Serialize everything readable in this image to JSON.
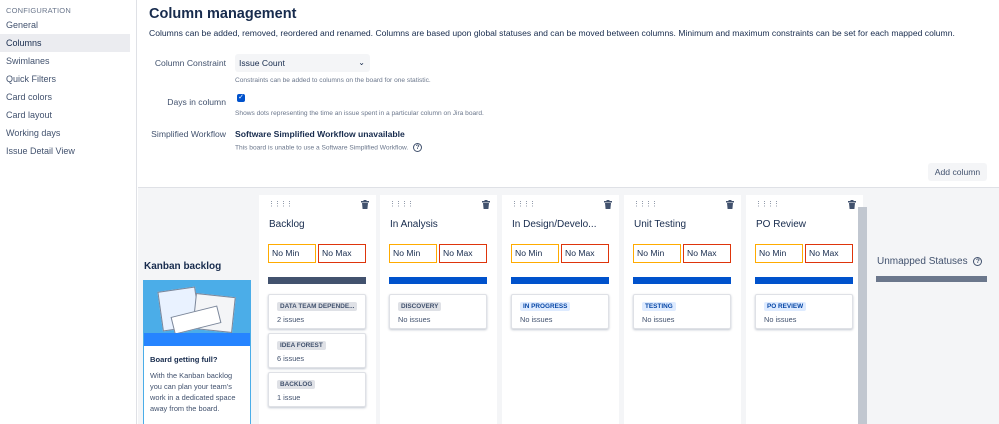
{
  "sidebar": {
    "heading": "CONFIGURATION",
    "items": [
      {
        "label": "General"
      },
      {
        "label": "Columns"
      },
      {
        "label": "Swimlanes"
      },
      {
        "label": "Quick Filters"
      },
      {
        "label": "Card colors"
      },
      {
        "label": "Card layout"
      },
      {
        "label": "Working days"
      },
      {
        "label": "Issue Detail View"
      }
    ],
    "active": "Columns"
  },
  "page": {
    "title": "Column management",
    "description": "Columns can be added, removed, reordered and renamed. Columns are based upon global statuses and can be moved between columns. Minimum and maximum constraints can be set for each mapped column."
  },
  "form": {
    "constraint_label": "Column Constraint",
    "constraint_value": "Issue Count",
    "constraint_help": "Constraints can be added to columns on the board for one statistic.",
    "days_label": "Days in column",
    "days_checked": true,
    "days_help": "Shows dots representing the time an issue spent in a particular column on Jira board.",
    "workflow_label": "Simplified Workflow",
    "workflow_title": "Software Simplified Workflow unavailable",
    "workflow_help": "This board is unable to use a Software Simplified Workflow."
  },
  "add_column_label": "Add column",
  "backlog": {
    "title": "Kanban backlog",
    "promo_heading": "Board getting full?",
    "promo_text": "With the Kanban backlog you can plan your team's work in a dedicated space away from the board."
  },
  "columns": [
    {
      "name": "Backlog",
      "min": "No Min",
      "max": "No Max",
      "bar_color": "#42526e",
      "statuses": [
        {
          "name": "DATA TEAM DEPENDE...",
          "count": "2 issues",
          "style": "grey"
        },
        {
          "name": "IDEA FOREST",
          "count": "6 issues",
          "style": "grey"
        },
        {
          "name": "BACKLOG",
          "count": "1 issue",
          "style": "grey"
        }
      ]
    },
    {
      "name": "In Analysis",
      "min": "No Min",
      "max": "No Max",
      "bar_color": "#0052cc",
      "statuses": [
        {
          "name": "DISCOVERY",
          "count": "No issues",
          "style": "grey"
        }
      ]
    },
    {
      "name": "In Design/Develo...",
      "min": "No Min",
      "max": "No Max",
      "bar_color": "#0052cc",
      "statuses": [
        {
          "name": "IN PROGRESS",
          "count": "No issues",
          "style": "blue"
        }
      ]
    },
    {
      "name": "Unit Testing",
      "min": "No Min",
      "max": "No Max",
      "bar_color": "#0052cc",
      "statuses": [
        {
          "name": "TESTING",
          "count": "No issues",
          "style": "blue"
        }
      ]
    },
    {
      "name": "PO Review",
      "min": "No Min",
      "max": "No Max",
      "bar_color": "#0052cc",
      "statuses": [
        {
          "name": "PO REVIEW",
          "count": "No issues",
          "style": "blue"
        }
      ]
    }
  ],
  "unmapped": {
    "title": "Unmapped Statuses"
  }
}
